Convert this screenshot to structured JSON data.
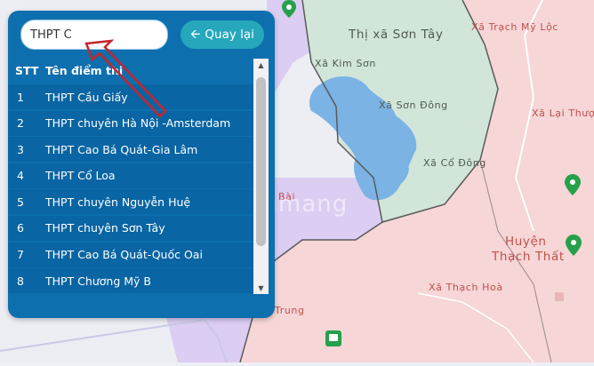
{
  "search": {
    "value": "THPT C"
  },
  "back_button": {
    "label": "Quay lại",
    "icon": "arrow-left-icon"
  },
  "table": {
    "headers": {
      "stt": "STT",
      "name": "Tên điểm thi"
    },
    "rows": [
      {
        "stt": "1",
        "name": "THPT Cầu Giấy"
      },
      {
        "stt": "2",
        "name": "THPT chuyên Hà Nội -Amsterdam"
      },
      {
        "stt": "3",
        "name": "THPT Cao Bá Quát-Gia Lâm"
      },
      {
        "stt": "4",
        "name": "THPT Cổ Loa"
      },
      {
        "stt": "5",
        "name": "THPT chuyên Nguyễn Huệ"
      },
      {
        "stt": "6",
        "name": "THPT chuyên Sơn Tây"
      },
      {
        "stt": "7",
        "name": "THPT Cao Bá Quát-Quốc Oai"
      },
      {
        "stt": "8",
        "name": "THPT Chương Mỹ B"
      }
    ]
  },
  "map": {
    "labels": {
      "son_tay": "Thị xã Sơn Tây",
      "kim_son": "Xã Kim Sơn",
      "son_dong": "Xã Sơn Đông",
      "co_dong": "Xã Cổ Đông",
      "trach_my_loc": "Xã Trạch Mỹ Lộc",
      "lai_thuong": "Xã Lại Thượ",
      "huyen_thach_that_1": "Huyện",
      "huyen_thach_that_2": "Thạch Thất",
      "thach_hoa": "Xã Thạch Hoà",
      "trung": "Trung",
      "bai": "Bài"
    },
    "colors": {
      "son_tay_area": "#d2e5d9",
      "purple_area": "#dccdf3",
      "pink_area": "#f6d6d6",
      "lake": "#7ab3e4",
      "border": "#5a5a5a",
      "pin": "#26a04a"
    }
  },
  "watermark": {
    "text": "uantrimang"
  }
}
